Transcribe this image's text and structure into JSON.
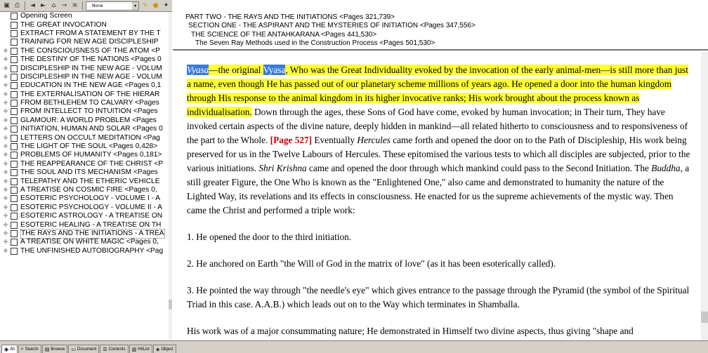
{
  "toolbar": {
    "file_type": "None",
    "icons": [
      "save-icon",
      "print-icon",
      "back-icon",
      "forward-icon",
      "home-icon",
      "go-icon",
      "list-icon",
      "highlight-icon",
      "note-icon",
      "bookmark-icon"
    ]
  },
  "tree": [
    {
      "label": "Opening Screen",
      "exp": false
    },
    {
      "label": "THE GREAT INVOCATION",
      "exp": false
    },
    {
      "label": "EXTRACT FROM A STATEMENT BY THE T",
      "exp": false
    },
    {
      "label": "TRAINING FOR NEW AGE DISCIPLESHIP",
      "exp": false
    },
    {
      "label": "THE CONSCIOUSNESS OF THE ATOM <P",
      "exp": true
    },
    {
      "label": "THE DESTINY OF THE NATIONS <Pages 0",
      "exp": true
    },
    {
      "label": "DISCIPLESHIP IN THE NEW AGE - VOLUM",
      "exp": true
    },
    {
      "label": "DISCIPLESHIP IN THE NEW AGE - VOLUM",
      "exp": true
    },
    {
      "label": "EDUCATION IN THE NEW AGE <Pages 0,1",
      "exp": true
    },
    {
      "label": "THE EXTERNALISATION OF THE HIERAR",
      "exp": true
    },
    {
      "label": "FROM BETHLEHEM TO CALVARY <Pages",
      "exp": true
    },
    {
      "label": "FROM INTELLECT TO INTUITION <Pages",
      "exp": true
    },
    {
      "label": "GLAMOUR: A WORLD PROBLEM <Pages",
      "exp": true
    },
    {
      "label": "INITIATION, HUMAN AND SOLAR <Pages 0",
      "exp": true
    },
    {
      "label": "LETTERS ON OCCULT MEDITATION <Pag",
      "exp": true
    },
    {
      "label": "THE LIGHT OF THE SOUL <Pages 0,428>",
      "exp": true
    },
    {
      "label": "PROBLEMS OF HUMANITY <Pages 0,181>",
      "exp": true
    },
    {
      "label": "THE REAPPEARANCE OF THE CHRIST <P",
      "exp": true
    },
    {
      "label": "THE SOUL AND ITS MECHANISM <Pages",
      "exp": true
    },
    {
      "label": "TELEPATHY AND THE ETHERIC VEHICLE",
      "exp": true
    },
    {
      "label": "A TREATISE ON COSMIC FIRE <Pages 0,",
      "exp": true
    },
    {
      "label": "ESOTERIC PSYCHOLOGY - VOLUME I - A",
      "exp": true
    },
    {
      "label": "ESOTERIC PSYCHOLOGY - VOLUME II - A",
      "exp": true
    },
    {
      "label": "ESOTERIC ASTROLOGY - A TREATISE ON",
      "exp": true
    },
    {
      "label": "ESOTERIC HEALING - A TREATISE ON TH",
      "exp": true
    },
    {
      "label": "THE RAYS AND THE INITIATIONS - A TREA",
      "exp": true,
      "selected": true
    },
    {
      "label": "A TREATISE ON WHITE MAGIC <Pages 0,",
      "exp": true
    },
    {
      "label": "THE UNFINISHED AUTOBIOGRAPHY <Pag",
      "exp": true
    }
  ],
  "breadcrumb": {
    "l1": "PART TWO - THE RAYS AND THE INITIATIONS <Pages 321,739>",
    "l2": "SECTION ONE - THE ASPIRANT AND THE MYSTERIES OF INITIATION <Pages 347,556>",
    "l3": "THE SCIENCE OF THE ANTAHKARANA <Pages 441,530>",
    "l4": "The Seven Ray Methods used in the Construction Process <Pages 501,530>"
  },
  "content": {
    "p1": {
      "word1": "Vyasa",
      "dash1": "—the original ",
      "word2": "Vyasa",
      "hl_rest": ", Who was the Great Individuality evoked by the invocation of the early animal-men—is still more than just a name, even though He has passed out of our planetary scheme millions of years ago.  He opened a door into the human kingdom through His response to the animal kingdom in its higher invocative ranks; His work brought about the process known as individualisation.",
      "t1": "  Down through the ages, these Sons of God have come, evoked by human invocation; in Their turn, They have invoked certain aspects of the divine nature, deeply hidden in mankind—all related hitherto to consciousness and to responsiveness of the part to the Whole.  ",
      "page_ref": "[Page 527]",
      "t2": " Eventually ",
      "hercules": "Hercules",
      "t3": " came forth and opened the door on to the Path of Discipleship, His work being preserved for us in the Twelve Labours of Hercules.  These epitomised the various tests to which all disciples are subjected, prior to the various initiations.  ",
      "krishna": "Shri Krishna",
      "t4": " came and opened the door through which mankind could pass to the Second Initiation.  The ",
      "buddha": "Buddha",
      "t5": ", a still greater Figure, the One Who is known as the \"Enlightened One,\" also came and demonstrated to humanity the nature of the Lighted Way, its revelations and its effects in consciousness.  He enacted for us the supreme achievements of the mystic way.  Then came the Christ and performed a triple work:"
    },
    "p2": "1. He opened the door to the third initiation.",
    "p3": "2. He anchored on Earth \"the Will of God in the matrix of love\" (as it has been esoterically called).",
    "p4": "3. He pointed the way through \"the needle's eye\" which gives entrance to the passage through the Pyramid (the symbol of the Spiritual Triad in this case.  A.A.B.) which leads out on to the Way which terminates in Shamballa.",
    "p5": "His work was of a major consummating nature; He demonstrated in Himself two divine aspects, thus giving \"shape and"
  },
  "tabs": [
    {
      "label": "All",
      "icon": "all-icon",
      "active": true
    },
    {
      "label": "Search",
      "icon": "search-icon"
    },
    {
      "label": "Browse",
      "icon": "browse-icon"
    },
    {
      "label": "Document",
      "icon": "document-icon"
    },
    {
      "label": "Contents",
      "icon": "contents-icon"
    },
    {
      "label": "HitList",
      "icon": "hitlist-icon"
    },
    {
      "label": "Object",
      "icon": "object-icon"
    }
  ],
  "colors": {
    "highlight": "#ffff33",
    "selection": "#3a7bd5",
    "page_ref": "#c00000"
  }
}
